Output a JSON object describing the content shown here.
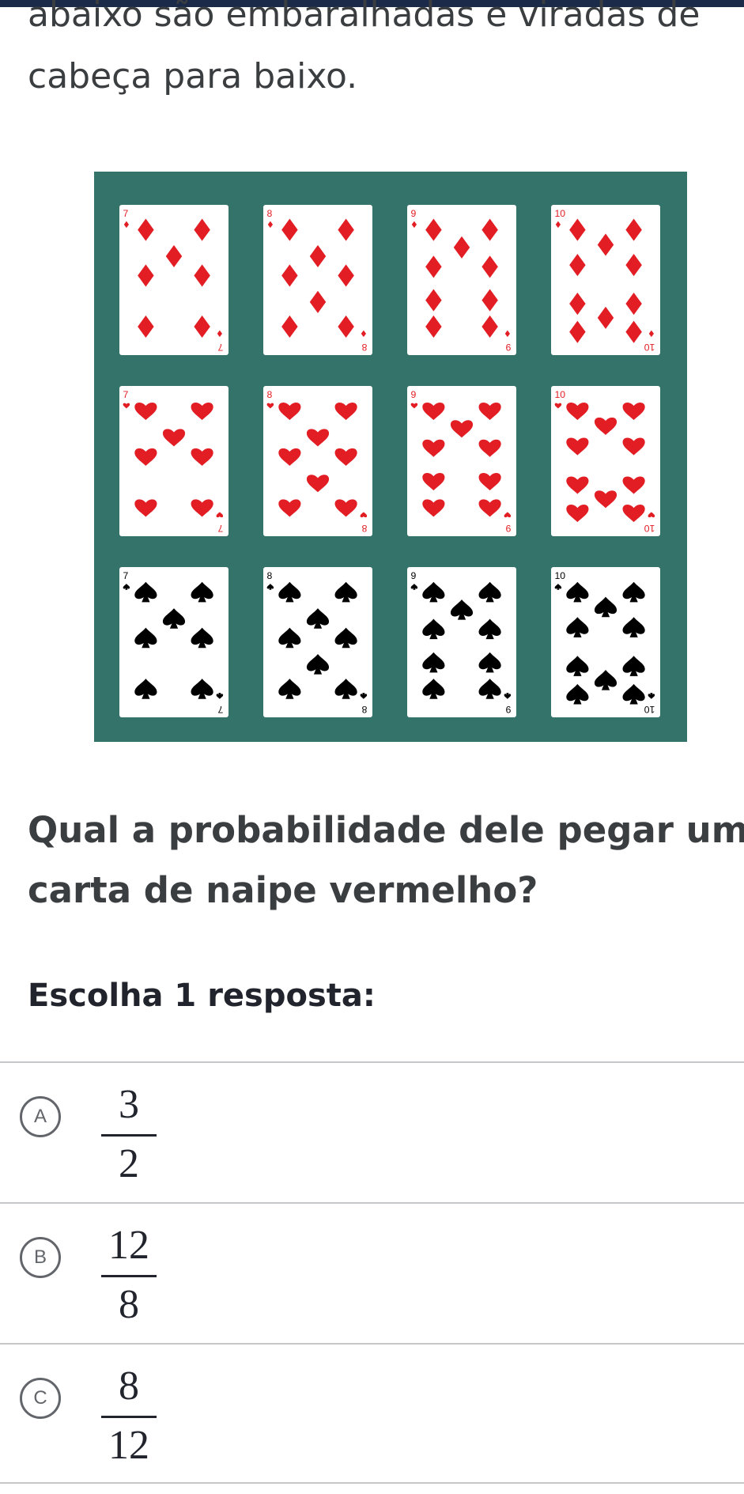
{
  "intro": {
    "line1": "abaixo são embaralhadas e viradas de",
    "line2": "cabeça para baixo."
  },
  "figure": {
    "background": "#33736a",
    "rows": [
      {
        "suit": "diamond-icon",
        "color": "#e21d24",
        "ranks": [
          "7",
          "8",
          "9",
          "10"
        ]
      },
      {
        "suit": "heart-icon",
        "color": "#e21d24",
        "ranks": [
          "7",
          "8",
          "9",
          "10"
        ]
      },
      {
        "suit": "spade-icon",
        "color": "#000000",
        "ranks": [
          "7",
          "8",
          "9",
          "10"
        ]
      }
    ]
  },
  "question": {
    "line1": "Qual a probabilidade dele pegar uma",
    "line2": "carta de naipe vermelho?"
  },
  "prompt": "Escolha 1 resposta:",
  "choices": [
    {
      "letter": "A",
      "numerator": "3",
      "denominator": "2"
    },
    {
      "letter": "B",
      "numerator": "12",
      "denominator": "8"
    },
    {
      "letter": "C",
      "numerator": "8",
      "denominator": "12"
    }
  ],
  "colors": {
    "accent": "#1c2a4a",
    "table_green": "#33736a",
    "red_suit": "#e21d24"
  }
}
